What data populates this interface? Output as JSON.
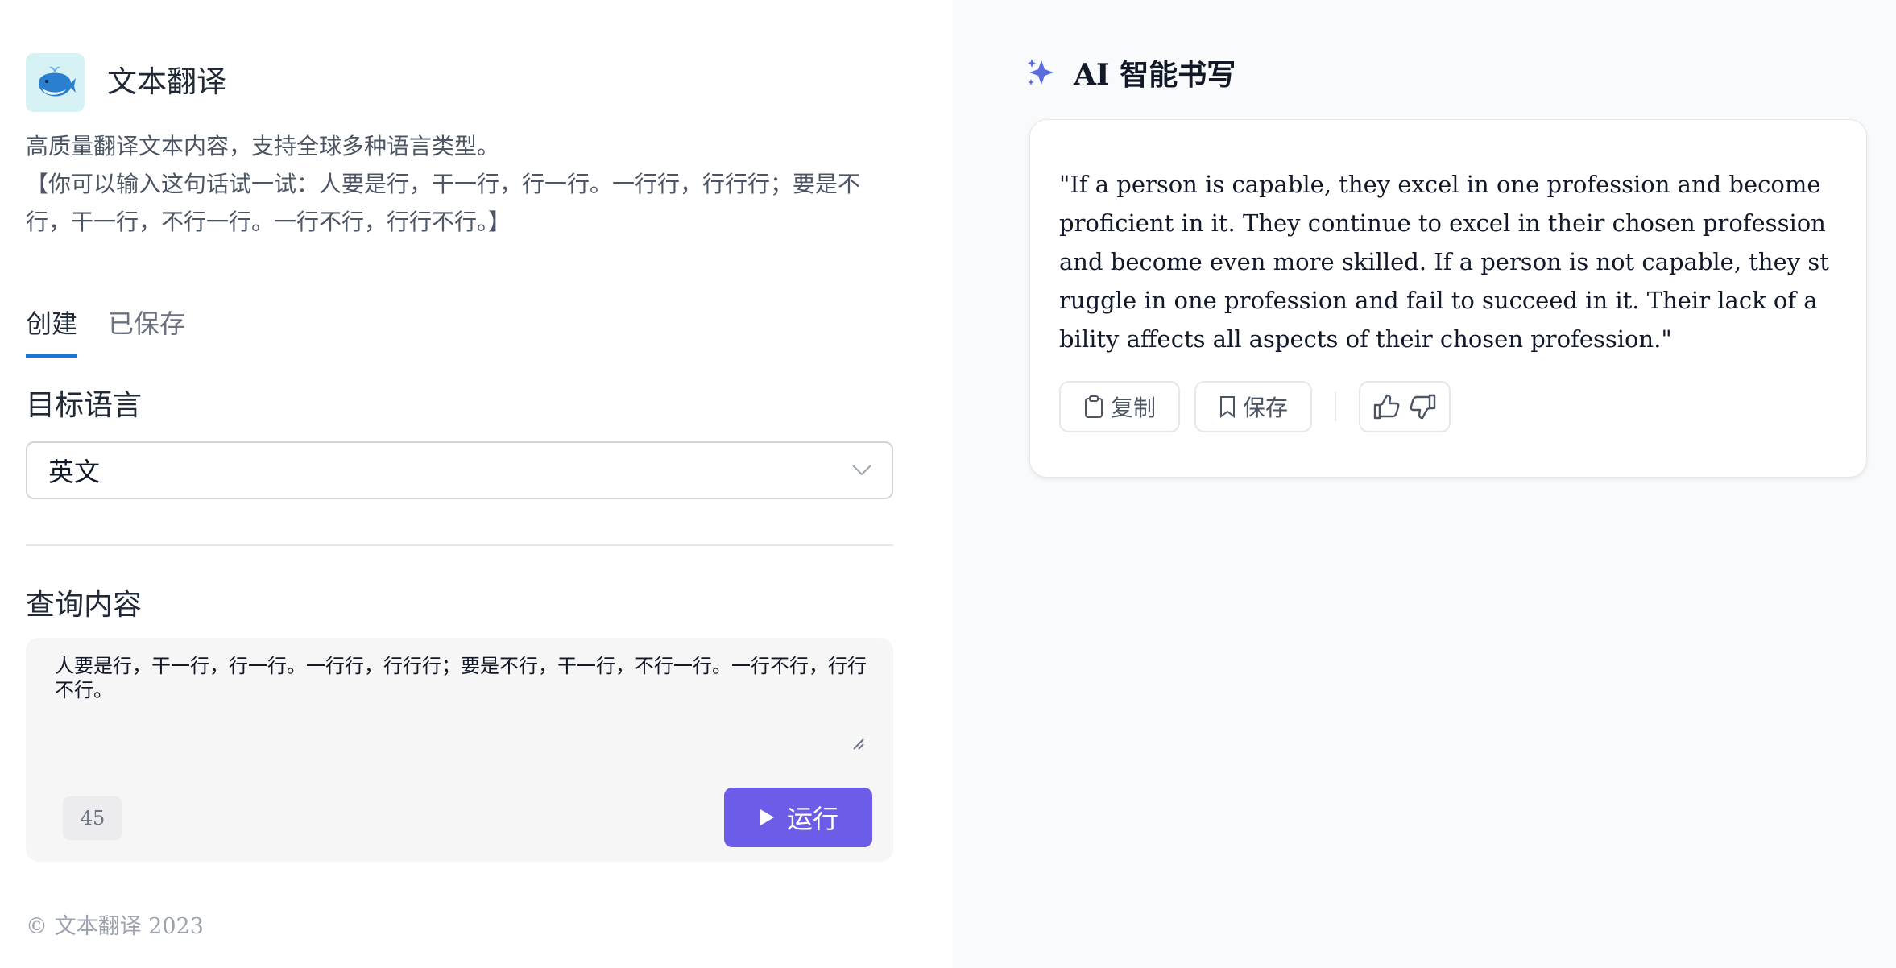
{
  "app": {
    "title": "文本翻译",
    "logo_icon": "whale-icon",
    "description_line1": "高质量翻译文本内容，支持全球多种语言类型。",
    "description_line2": "【你可以输入这句话试一试：人要是行，干一行，行一行。一行行，行行行；要是不行，干一行，不行一行。一行不行，行行不行。】"
  },
  "tabs": [
    {
      "label": "创建",
      "active": true
    },
    {
      "label": "已保存",
      "active": false
    }
  ],
  "form": {
    "target_language_label": "目标语言",
    "target_language_value": "英文",
    "query_label": "查询内容",
    "query_value": "人要是行，干一行，行一行。一行行，行行行；要是不行，干一行，不行一行。一行不行，行行不行。",
    "char_count": "45",
    "run_label": "运行"
  },
  "footer": "© 文本翻译 2023",
  "result": {
    "header_title": "AI 智能书写",
    "text": "\"If a person is capable, they excel in one profession and become proficient in it. They continue to excel in their chosen profession and become even more skilled. If a person is not capable, they struggle in one profession and fail to succeed in it. Their lack of ability affects all aspects of their chosen profession.\"",
    "copy_label": "复制",
    "save_label": "保存"
  },
  "colors": {
    "accent": "#6c5ce7",
    "tab_indicator": "#1677d2",
    "sparkle": "#5b6ee1"
  }
}
